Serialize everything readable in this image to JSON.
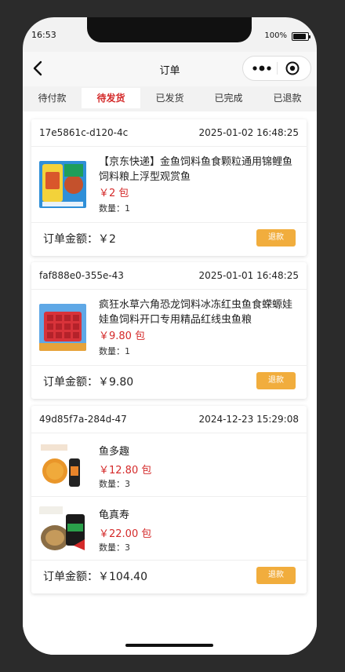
{
  "status": {
    "time": "16:53",
    "battery": "100%"
  },
  "nav": {
    "title": "订单"
  },
  "tabs": [
    {
      "label": "待付款"
    },
    {
      "label": "待发货"
    },
    {
      "label": "已发货"
    },
    {
      "label": "已完成"
    },
    {
      "label": "已退款"
    }
  ],
  "active_tab": "待发货",
  "orders": [
    {
      "id": "17e5861c-d120-4c",
      "date": "2025-01-02 16:48:25",
      "items": [
        {
          "title": "【京东快递】金鱼饲料鱼食颗粒通用锦鲤鱼饲料粮上浮型观赏鱼",
          "price": "￥2 包",
          "qty": "数量：1"
        }
      ],
      "total": "订单金额：￥2",
      "refund_label": "退款"
    },
    {
      "id": "faf888e0-355e-43",
      "date": "2025-01-01 16:48:25",
      "items": [
        {
          "title": "疯狂水草六角恐龙饲料冰冻红虫鱼食蝾螈娃娃鱼饲料开口专用精品红线虫鱼粮",
          "price": "￥9.80 包",
          "qty": "数量：1"
        }
      ],
      "total": "订单金额：￥9.80",
      "refund_label": "退款"
    },
    {
      "id": "49d85f7a-284d-47",
      "date": "2024-12-23 15:29:08",
      "items": [
        {
          "title": "鱼多趣",
          "price": "￥12.80 包",
          "qty": "数量：3"
        },
        {
          "title": "龟真寿",
          "price": "￥22.00 包",
          "qty": "数量：3"
        }
      ],
      "total": "订单金额：￥104.40",
      "refund_label": "退款"
    }
  ],
  "colors": {
    "accent_red": "#d42a2a",
    "refund_orange": "#f1ad3d"
  }
}
